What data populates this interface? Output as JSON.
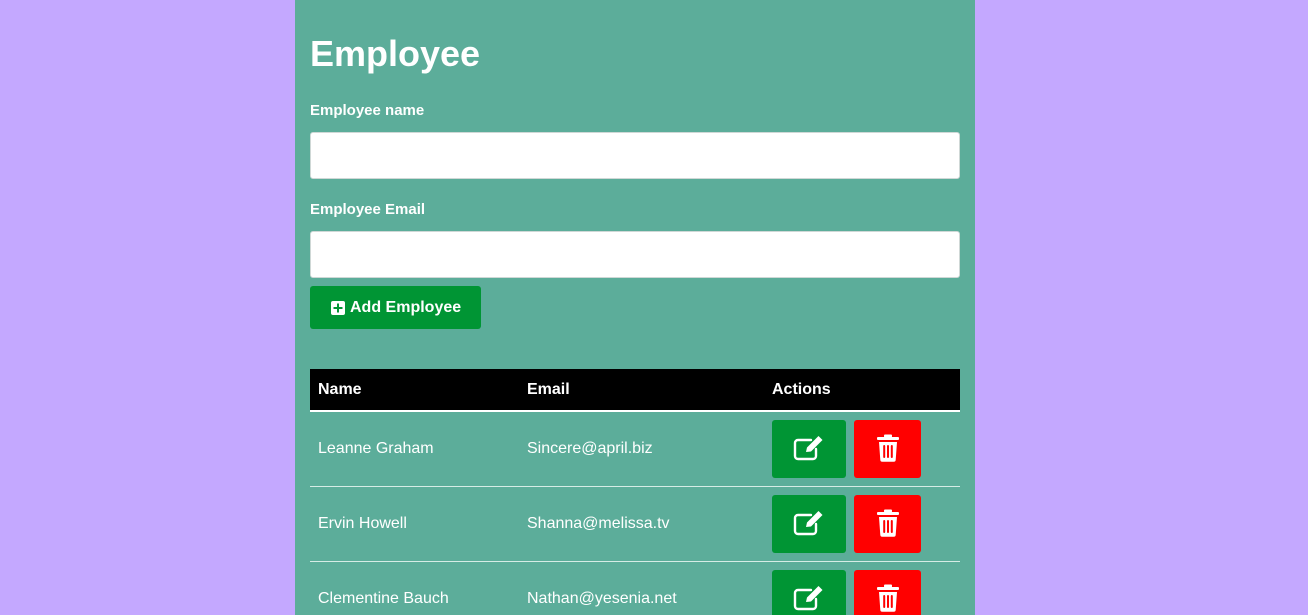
{
  "page": {
    "title": "Employee"
  },
  "form": {
    "name_label": "Employee name",
    "name_value": "",
    "email_label": "Employee Email",
    "email_value": "",
    "add_button_label": "Add Employee",
    "add_button_icon": "plus-square-icon"
  },
  "table": {
    "headers": {
      "name": "Name",
      "email": "Email",
      "actions": "Actions"
    },
    "rows": [
      {
        "name": "Leanne Graham",
        "email": "Sincere@april.biz"
      },
      {
        "name": "Ervin Howell",
        "email": "Shanna@melissa.tv"
      },
      {
        "name": "Clementine Bauch",
        "email": "Nathan@yesenia.net"
      }
    ],
    "edit_icon": "edit-icon",
    "delete_icon": "trash-icon"
  },
  "colors": {
    "page_background": "#c4a8ff",
    "panel_background": "#5cad9a",
    "primary_green": "#009534",
    "danger_red": "#ff0000",
    "header_black": "#000000"
  }
}
